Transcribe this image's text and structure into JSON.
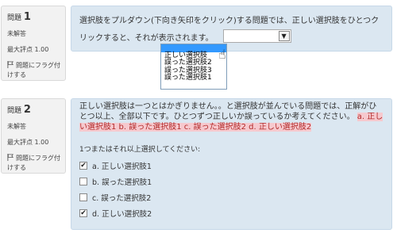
{
  "q1": {
    "number_label": "問題",
    "number": "1",
    "status": "未解答",
    "max_score": "最大評点 1.00",
    "flag_label": "問題にフラグ付けする",
    "text_before": "選択肢をプルダウン(下向き矢印をクリック)する問題では、正しい選択肢をひとつクリックすると、それが表示されます。",
    "select": {
      "selected": "",
      "arrow": "▼"
    },
    "options": [
      "",
      "正しい選択肢",
      "誤った選択肢2",
      "誤った選択肢3",
      "誤った選択肢1"
    ]
  },
  "q2": {
    "number_label": "問題",
    "number": "2",
    "status": "未解答",
    "max_score": "最大評点 1.00",
    "flag_label": "問題にフラグ付けする",
    "text": "正しい選択肢は一つとはかぎりません。。と選択肢が並んでいる問題では、正解がひとつ以上、全部以下です。ひとつずつ正しいか誤っているか考えてください。",
    "highlight": "a. 正しい選択肢1 b. 誤った選択肢1 c. 誤った選択肢2 d. 正しい選択肢2",
    "prompt": "1つまたはそれ以上選択してください:",
    "answers": [
      {
        "label": "a. 正しい選択肢1",
        "checked": true
      },
      {
        "label": "b. 誤った選択肢1",
        "checked": false
      },
      {
        "label": "c. 誤った選択肢2",
        "checked": false
      },
      {
        "label": "d. 正しい選択肢2",
        "checked": true
      }
    ]
  }
}
